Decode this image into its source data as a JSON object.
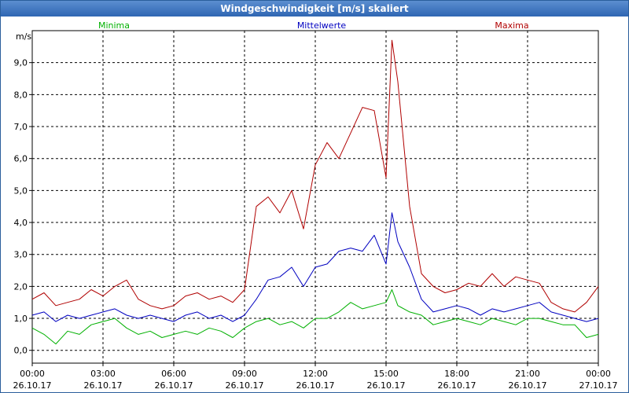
{
  "window": {
    "title": "Windgeschwindigkeit [m/s] skaliert"
  },
  "chart_data": {
    "type": "line",
    "title": "Windgeschwindigkeit [m/s] skaliert",
    "ylabel": "m/s",
    "xlabel": "",
    "ylim": [
      -0.4,
      10.0
    ],
    "yticks": [
      0,
      1,
      2,
      3,
      4,
      5,
      6,
      7,
      8,
      9
    ],
    "ytick_labels": [
      "0,0",
      "1,0",
      "2,0",
      "3,0",
      "4,0",
      "5,0",
      "6,0",
      "7,0",
      "8,0",
      "9,0"
    ],
    "xlim": [
      0,
      24
    ],
    "xticks": [
      0,
      3,
      6,
      9,
      12,
      15,
      18,
      21,
      24
    ],
    "xtick_labels": [
      [
        "00:00",
        "26.10.17"
      ],
      [
        "03:00",
        "26.10.17"
      ],
      [
        "06:00",
        "26.10.17"
      ],
      [
        "09:00",
        "26.10.17"
      ],
      [
        "12:00",
        "26.10.17"
      ],
      [
        "15:00",
        "26.10.17"
      ],
      [
        "18:00",
        "26.10.17"
      ],
      [
        "21:00",
        "26.10.17"
      ],
      [
        "00:00",
        "27.10.17"
      ]
    ],
    "grid": true,
    "legend_position": "top",
    "x": [
      0,
      0.5,
      1,
      1.5,
      2,
      2.5,
      3,
      3.5,
      4,
      4.5,
      5,
      5.5,
      6,
      6.5,
      7,
      7.5,
      8,
      8.5,
      9,
      9.5,
      10,
      10.5,
      11,
      11.5,
      12,
      12.5,
      13,
      13.5,
      14,
      14.5,
      15,
      15.25,
      15.5,
      16,
      16.5,
      17,
      17.5,
      18,
      18.5,
      19,
      19.5,
      20,
      20.5,
      21,
      21.5,
      22,
      22.5,
      23,
      23.5,
      24
    ],
    "series": [
      {
        "name": "Minima",
        "color": "#00b000",
        "values": [
          0.7,
          0.5,
          0.2,
          0.6,
          0.5,
          0.8,
          0.9,
          1.0,
          0.7,
          0.5,
          0.6,
          0.4,
          0.5,
          0.6,
          0.5,
          0.7,
          0.6,
          0.4,
          0.7,
          0.9,
          1.0,
          0.8,
          0.9,
          0.7,
          1.0,
          1.0,
          1.2,
          1.5,
          1.3,
          1.4,
          1.5,
          1.9,
          1.4,
          1.2,
          1.1,
          0.8,
          0.9,
          1.0,
          0.9,
          0.8,
          1.0,
          0.9,
          0.8,
          1.0,
          1.0,
          0.9,
          0.8,
          0.8,
          0.4,
          0.5
        ]
      },
      {
        "name": "Mittelwerte",
        "color": "#0000c0",
        "values": [
          1.1,
          1.2,
          0.9,
          1.1,
          1.0,
          1.1,
          1.2,
          1.3,
          1.1,
          1.0,
          1.1,
          1.0,
          0.9,
          1.1,
          1.2,
          1.0,
          1.1,
          0.9,
          1.1,
          1.6,
          2.2,
          2.3,
          2.6,
          2.0,
          2.6,
          2.7,
          3.1,
          3.2,
          3.1,
          3.6,
          2.7,
          4.3,
          3.4,
          2.6,
          1.6,
          1.2,
          1.3,
          1.4,
          1.3,
          1.1,
          1.3,
          1.2,
          1.3,
          1.4,
          1.5,
          1.2,
          1.1,
          1.0,
          0.9,
          1.0
        ]
      },
      {
        "name": "Maxima",
        "color": "#b00000",
        "values": [
          1.6,
          1.8,
          1.4,
          1.5,
          1.6,
          1.9,
          1.7,
          2.0,
          2.2,
          1.6,
          1.4,
          1.3,
          1.4,
          1.7,
          1.8,
          1.6,
          1.7,
          1.5,
          1.9,
          4.5,
          4.8,
          4.3,
          5.0,
          3.8,
          5.8,
          6.5,
          6.0,
          6.8,
          7.6,
          7.5,
          5.4,
          9.7,
          8.4,
          4.5,
          2.4,
          2.0,
          1.8,
          1.9,
          2.1,
          2.0,
          2.4,
          2.0,
          2.3,
          2.2,
          2.1,
          1.5,
          1.3,
          1.2,
          1.5,
          2.0
        ]
      }
    ]
  }
}
